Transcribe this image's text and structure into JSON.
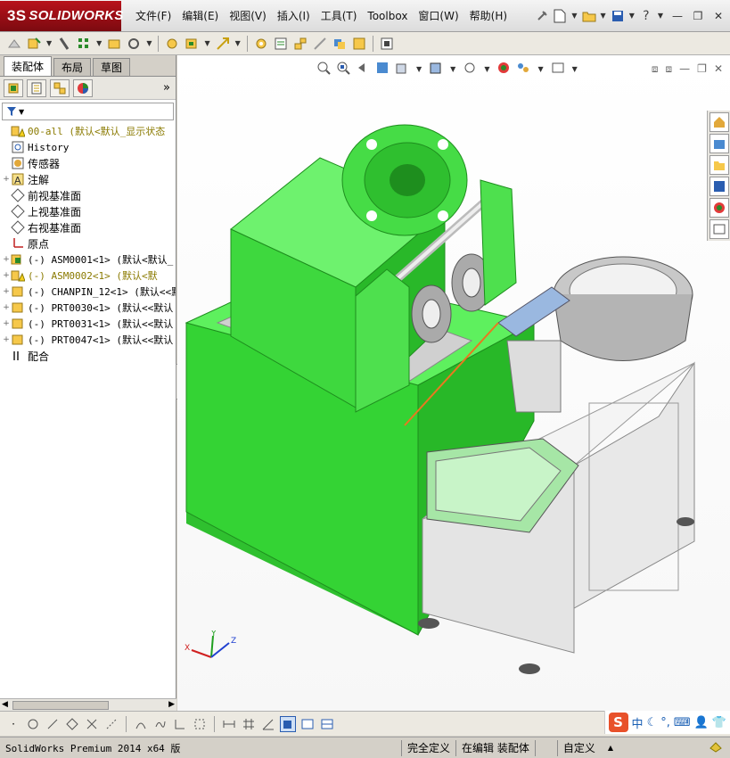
{
  "app": {
    "brand": "SOLIDWORKS",
    "brand_prefix": "3S"
  },
  "menu": {
    "items": [
      "文件(F)",
      "编辑(E)",
      "视图(V)",
      "插入(I)",
      "工具(T)",
      "Toolbox",
      "窗口(W)",
      "帮助(H)"
    ]
  },
  "left_panel": {
    "tabs": [
      "装配体",
      "布局",
      "草图"
    ],
    "active_tab": "装配体",
    "more_glyph": "»",
    "filter_glyph": "▼",
    "tree": [
      {
        "label": "00-all  (默认<默认_显示状态",
        "icon": "assembly-warning-icon",
        "mono": true,
        "warn": true,
        "expand": ""
      },
      {
        "label": "History",
        "icon": "history-icon",
        "mono": true,
        "expand": ""
      },
      {
        "label": "传感器",
        "icon": "sensor-icon",
        "expand": ""
      },
      {
        "label": "注解",
        "icon": "annotation-icon",
        "expand": "+"
      },
      {
        "label": "前视基准面",
        "icon": "plane-icon",
        "expand": ""
      },
      {
        "label": "上视基准面",
        "icon": "plane-icon",
        "expand": ""
      },
      {
        "label": "右视基准面",
        "icon": "plane-icon",
        "expand": ""
      },
      {
        "label": "原点",
        "icon": "origin-icon",
        "expand": ""
      },
      {
        "label": "(-) ASM0001<1> (默认<默认_",
        "icon": "subassembly-icon",
        "mono": true,
        "expand": "+"
      },
      {
        "label": "(-) ASM0002<1> (默认<默",
        "icon": "subassembly-warning-icon",
        "mono": true,
        "warn": true,
        "expand": "+"
      },
      {
        "label": "(-) CHANPIN_12<1> (默认<<默",
        "icon": "part-icon",
        "mono": true,
        "expand": "+"
      },
      {
        "label": "(-) PRT0030<1> (默认<<默认",
        "icon": "part-icon",
        "mono": true,
        "expand": "+"
      },
      {
        "label": "(-) PRT0031<1> (默认<<默认",
        "icon": "part-icon",
        "mono": true,
        "expand": "+"
      },
      {
        "label": "(-) PRT0047<1> (默认<<默认",
        "icon": "part-icon",
        "mono": true,
        "expand": "+"
      },
      {
        "label": "配合",
        "icon": "mates-icon",
        "expand": ""
      }
    ]
  },
  "triad": {
    "x": "X",
    "y": "Y",
    "z": "Z"
  },
  "status_bar": {
    "version": "SolidWorks Premium 2014 x64 版",
    "definition": "完全定义",
    "editing": "在编辑 装配体",
    "units": "自定义",
    "units_arrow": "▲"
  },
  "ime": {
    "logo": "S",
    "lang": "中"
  },
  "colors": {
    "machine_green": "#3ee23e",
    "brand_red": "#b8121b",
    "cabinet": "#eeeeee"
  }
}
